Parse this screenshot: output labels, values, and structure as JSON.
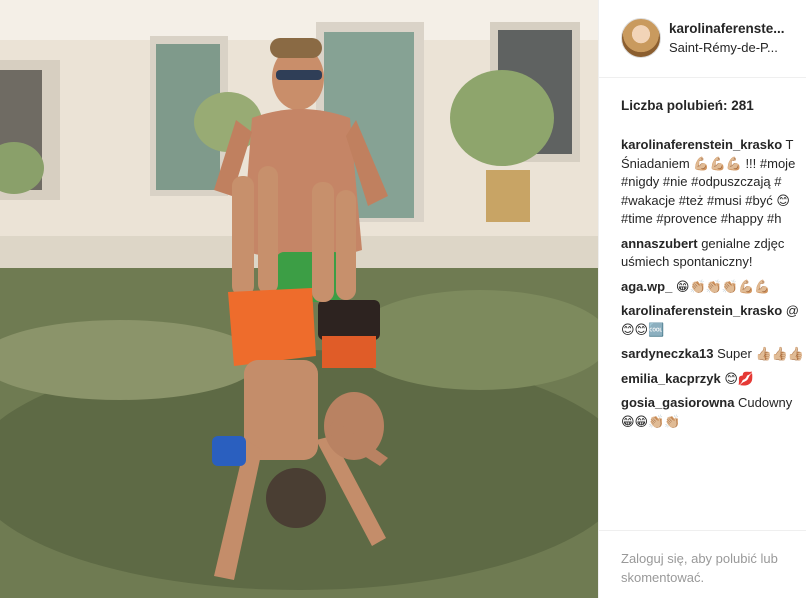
{
  "post": {
    "username": "karolinaferenste...",
    "location": "Saint-Rémy-de-P...",
    "likes_label": "Liczba polubień: 281"
  },
  "caption": {
    "author": "karolinaferenstein_krasko",
    "lines": [
      "T",
      "Śniadaniem 💪🏼💪🏼💪🏼 !!! #moje",
      "#nigdy #nie #odpuszczają #",
      "#wakacje #też #musi #być 😊",
      "#time #provence #happy #h"
    ]
  },
  "comments": [
    {
      "author": "annaszubert",
      "lines": [
        "genialne zdjęc",
        "uśmiech spontaniczny!"
      ]
    },
    {
      "author": "aga.wp_",
      "lines": [
        "😁👏🏼👏🏼👏🏼💪🏼💪🏼"
      ]
    },
    {
      "author": "karolinaferenstein_krasko",
      "lines": [
        "@",
        "😊😊🆒"
      ]
    },
    {
      "author": "sardyneczka13",
      "lines": [
        "Super 👍🏼👍🏼👍🏼"
      ]
    },
    {
      "author": "emilia_kacprzyk",
      "lines": [
        "😊💋"
      ]
    },
    {
      "author": "gosia_gasiorowna",
      "lines": [
        "Cudowny",
        "😁😁👏🏼👏🏼"
      ]
    }
  ],
  "footer": {
    "login_link": "Zaloguj się",
    "rest": ", aby polubić lub skomentować."
  },
  "icons": {
    "avatar": "profile-photo"
  }
}
